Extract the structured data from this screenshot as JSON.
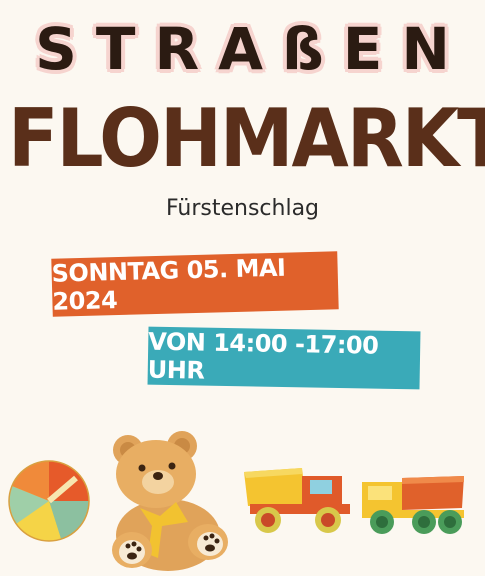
{
  "title_top": "STRAßEN",
  "title_main": "FLOHMARKT",
  "location": "Fürstenschlag",
  "date": "SONNTAG 05. MAI 2024",
  "time": "VON 14:00 -17:00 UHR",
  "colors": {
    "background": "#fcf8f1",
    "title_top": "#2b1b12",
    "title_top_outline": "#f6d4cf",
    "title_main": "#5a2f1a",
    "date_banner": "#e0612b",
    "time_banner": "#3aaab8"
  },
  "illustrations": [
    "beach-ball-icon",
    "teddy-bear-icon",
    "dump-truck-icon",
    "dump-truck-icon"
  ]
}
